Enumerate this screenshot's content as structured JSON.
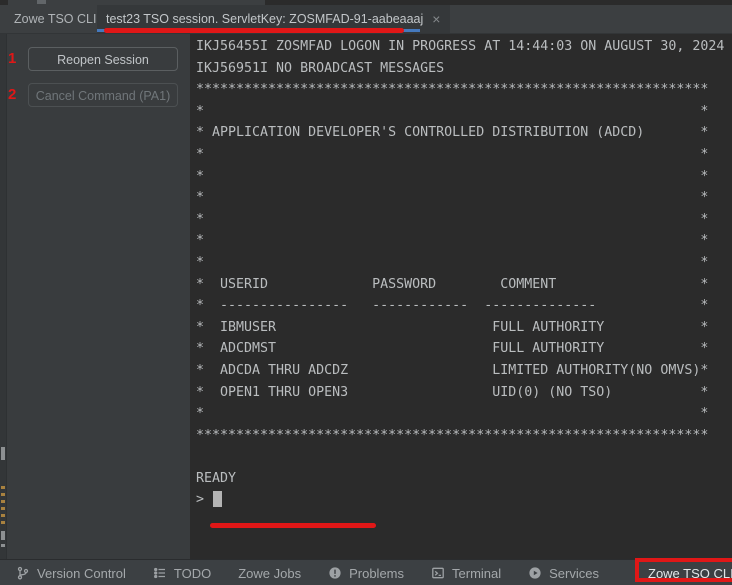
{
  "header": {
    "tool_label": "Zowe TSO CLI:",
    "tab": {
      "title": "test23 TSO session. ServletKey: ZOSMFAD-91-aabeaaaj",
      "close_glyph": "×"
    }
  },
  "sidebar": {
    "annotations": [
      {
        "number": "1"
      },
      {
        "number": "2"
      }
    ],
    "buttons": [
      {
        "label": "Reopen Session",
        "enabled": true
      },
      {
        "label": "Cancel Command (PA1)",
        "enabled": false
      }
    ]
  },
  "terminal": {
    "lines": [
      "IKJ56455I ZOSMFAD LOGON IN PROGRESS AT 14:44:03 ON AUGUST 30, 2024",
      "IKJ56951I NO BROADCAST MESSAGES",
      "****************************************************************",
      "*                                                              *",
      "* APPLICATION DEVELOPER'S CONTROLLED DISTRIBUTION (ADCD)       *",
      "*                                                              *",
      "*                                                              *",
      "*                                                              *",
      "*                                                              *",
      "*                                                              *",
      "*                                                              *",
      "*  USERID             PASSWORD        COMMENT                  *",
      "*  ----------------   ------------  --------------             *",
      "*  IBMUSER                           FULL AUTHORITY            *",
      "*  ADCDMST                           FULL AUTHORITY            *",
      "*  ADCDA THRU ADCDZ                  LIMITED AUTHORITY(NO OMVS)*",
      "*  OPEN1 THRU OPEN3                  UID(0) (NO TSO)           *",
      "*                                                              *",
      "****************************************************************",
      "",
      "READY",
      "> "
    ]
  },
  "statusbar": {
    "items": [
      {
        "label": "Version Control",
        "icon": "git-branch-icon"
      },
      {
        "label": "TODO",
        "icon": "todo-list-icon"
      },
      {
        "label": "Zowe Jobs",
        "icon": null
      },
      {
        "label": "Problems",
        "icon": "problems-icon"
      },
      {
        "label": "Terminal",
        "icon": "terminal-icon"
      },
      {
        "label": "Services",
        "icon": "services-icon"
      },
      {
        "label": "Zowe TSO CLI",
        "icon": null,
        "active": true,
        "highlighted": true
      }
    ]
  },
  "colors": {
    "annotation_red": "#e01717",
    "tab_indicator_blue": "#4579bd",
    "terminal_bg": "#2b2b2b",
    "panel_bg": "#3c3f41",
    "terminal_text": "#babdbf"
  }
}
